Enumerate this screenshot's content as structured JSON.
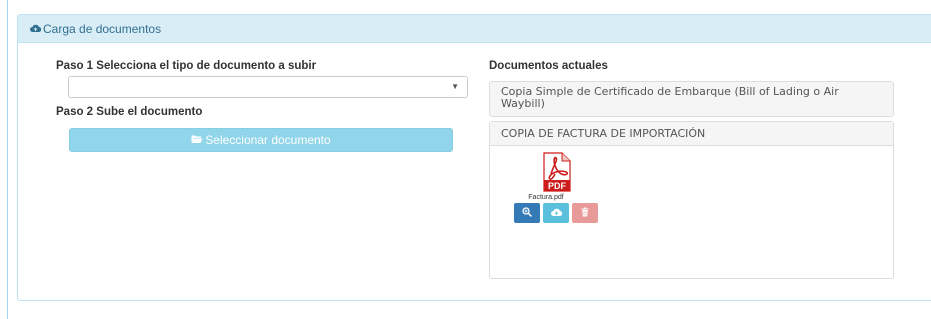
{
  "panel": {
    "title": "Carga de documentos"
  },
  "step1": {
    "label": "Paso 1 Selecciona el tipo de documento a subir",
    "select_value": ""
  },
  "step2": {
    "label": "Paso 2 Sube el documento",
    "button_label": "Seleccionar documento"
  },
  "current_docs": {
    "title": "Documentos actuales",
    "items": [
      {
        "label": "Copia Simple de Certificado de Embarque (Bill of Lading o Air Waybill)"
      },
      {
        "label": "COPIA DE FACTURA DE IMPORTACIÓN",
        "file": {
          "name": "Factura.pdf",
          "type_label": "PDF"
        }
      }
    ]
  },
  "icons": {
    "panel_icon": "cloud-upload-icon",
    "button_icon": "folder-open-icon",
    "file_icon": "pdf-file-icon",
    "view": "zoom-icon",
    "download": "cloud-download-icon",
    "delete": "trash-icon"
  },
  "colors": {
    "heading_bg": "#d9edf7",
    "heading_text": "#31708f",
    "upload_button": "#91d5ea",
    "view_button": "#337ab7",
    "download_button": "#5bc0de",
    "delete_button": "#e89a98",
    "pdf_red": "#cc1c1c"
  }
}
